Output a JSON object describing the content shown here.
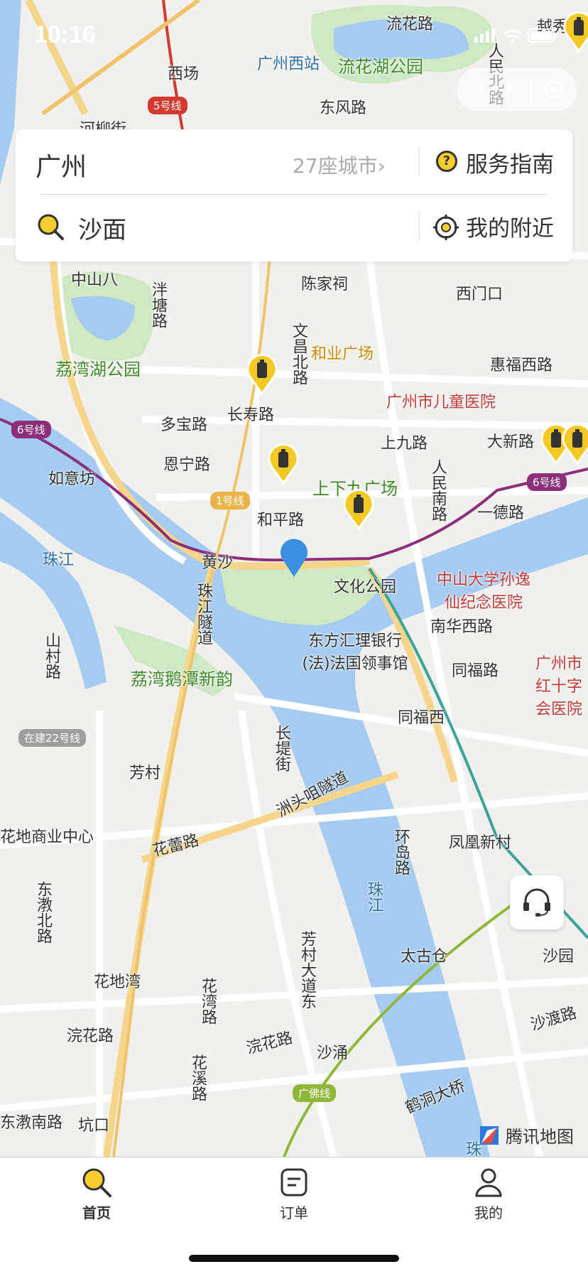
{
  "status_bar": {
    "time": "10:16",
    "system_icons": "signal wifi battery"
  },
  "capsule": {
    "more_label": "•••"
  },
  "search_card": {
    "city": "广州",
    "city_count": "27座城市",
    "city_chevron": "›",
    "guide_icon_glyph": "?",
    "guide_label": "服务指南",
    "search_text": "沙面",
    "nearby_label": "我的附近"
  },
  "map": {
    "labels": {
      "xichang": "西场",
      "guangzhou_west": "广州西站",
      "liuhua_park": "流花湖公园",
      "liuhua_rd": "流花路",
      "dongfeng_rd": "东风路",
      "yuexiu": "越秀",
      "renmin_north": "人民北路",
      "zhongshan8": "中山八",
      "chenjiaci": "陈家祠",
      "ximenkou": "西门口",
      "yangtang_rd": "泮塘路",
      "liwan_lake_park": "荔湾湖公园",
      "wenchang_north": "文昌北路",
      "heye_plaza": "和业广场",
      "huifu_west": "惠福西路",
      "changshou_rd": "长寿路",
      "children_hospital": "广州市儿童医院",
      "duobao_rd": "多宝路",
      "shangjiu_rd": "上九路",
      "daxin_rd": "大新路",
      "enning_rd": "恩宁路",
      "ruyifang": "如意坊",
      "xiajiu_plaza": "上下九广场",
      "renmin_south": "人民南路",
      "yide_rd": "一德路",
      "heping_rd": "和平路",
      "pearl_river_1": "珠江",
      "huangsha": "黄沙",
      "culture_park": "文化公园",
      "sysu_hospital": "中山大学孙逸仙纪念医院",
      "zhujiang_tunnel": "珠江隧道",
      "bank_consulate": "东方汇理银行(法)法国领事馆",
      "nanhua_west": "南华西路",
      "tongfu_rd": "同福路",
      "redcross": "广州市红十字会医院",
      "shancun_rd": "山村路",
      "liwan_pond": "荔湾鹅潭新韵",
      "tongfu_west": "同福西",
      "changdi_st": "长堤街",
      "fangcun": "芳村",
      "zhoutouzui_tunnel": "洲头咀隧道",
      "huadi_center": "花地商业中心",
      "huadi_rd": "花蕾路",
      "huandao_rd": "环岛路",
      "fenghuang_village": "凤凰新村",
      "dongjiao_north": "东漖北路",
      "pearl_river_2": "珠江",
      "taiguca": "太古仓",
      "shayuan": "沙园",
      "huadiwan": "花地湾",
      "huawan_rd": "花湾路",
      "fangcun_ave_east": "芳村大道东",
      "wanhua_rd": "浣花路",
      "wanhua_rd2": "浣花路",
      "shachong": "沙涌",
      "shadu_rd": "沙渡路",
      "huaxi_rd": "花溪路",
      "hedong_bridge": "鹤洞大桥",
      "dongjiao_south": "东漖南路",
      "kengkou": "坑口",
      "hefu_street": "河柳街",
      "zhuyu": "珠"
    },
    "line_badges": {
      "line5": "5号线",
      "line6_left": "6号线",
      "line1": "1号线",
      "line6_right": "6号线",
      "line22": "在建22号线",
      "guangfo": "广佛线"
    },
    "colors": {
      "water": "#a6cbf0",
      "land": "#f1f0ec",
      "park": "#cfe8c4",
      "line6": "#8c2f7a",
      "line1": "#efc36a",
      "line5": "#d23a2d",
      "guangfo": "#8fb83b",
      "marker": "#3c90e0",
      "locker": "#f3c820"
    }
  },
  "service_button": {
    "icon": "headset-icon"
  },
  "brand": {
    "label": "腾讯地图"
  },
  "tabbar": {
    "tabs": [
      {
        "label": "首页",
        "icon": "search-icon",
        "active": true
      },
      {
        "label": "订单",
        "icon": "order-icon",
        "active": false
      },
      {
        "label": "我的",
        "icon": "user-icon",
        "active": false
      }
    ]
  }
}
